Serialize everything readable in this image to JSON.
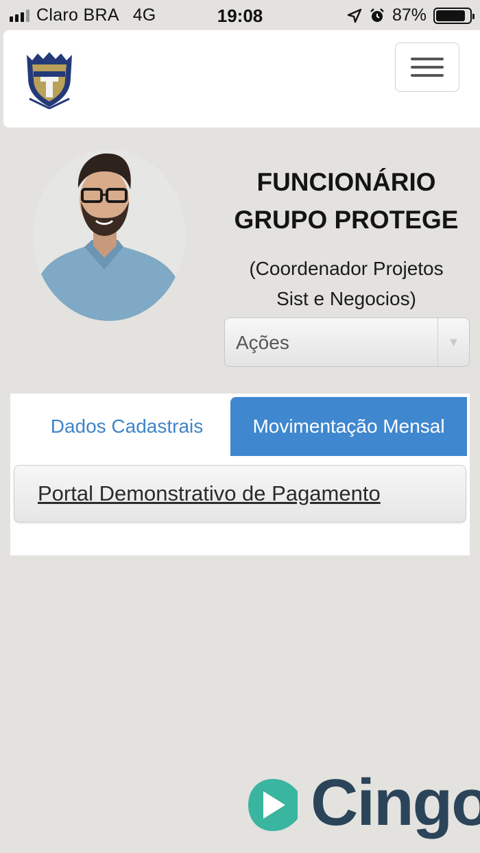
{
  "status_bar": {
    "carrier": "Claro BRA",
    "network": "4G",
    "time": "19:08",
    "battery": "87%",
    "battery_level": 0.87,
    "icons": [
      "signal-icon",
      "location-arrow-icon",
      "alarm-icon",
      "battery-icon"
    ]
  },
  "header": {
    "logo_icon": "protege-shield-logo",
    "menu_icon": "hamburger-icon"
  },
  "profile": {
    "title_line1": "FUNCIONÁRIO",
    "title_line2": "GRUPO PROTEGE",
    "role_line1": "(Coordenador Projetos",
    "role_line2": "Sist e Negocios)",
    "actions_select": "Ações"
  },
  "tabs": [
    {
      "label": "Dados Cadastrais",
      "active": false
    },
    {
      "label": "Movimentação Mensal",
      "active": true
    }
  ],
  "content": {
    "link_label": "Portal Demonstrativo de Pagamento"
  },
  "footer": {
    "brand": "Cingo"
  },
  "colors": {
    "background": "#e3e2de",
    "accent_blue": "#3f87cf",
    "brand_teal": "#3ab5a0",
    "brand_navy": "#2b4459"
  }
}
